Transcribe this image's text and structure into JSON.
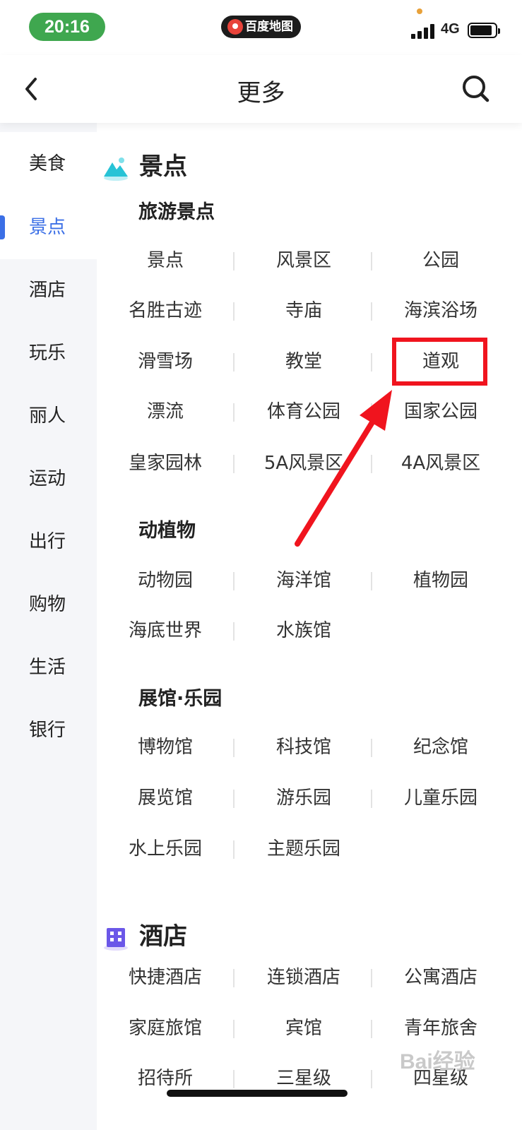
{
  "status_bar": {
    "time": "20:16",
    "app_name": "百度地图",
    "network": "4G"
  },
  "header": {
    "title": "更多"
  },
  "sidebar": {
    "items": [
      {
        "label": "美食"
      },
      {
        "label": "景点"
      },
      {
        "label": "酒店"
      },
      {
        "label": "玩乐"
      },
      {
        "label": "丽人"
      },
      {
        "label": "运动"
      },
      {
        "label": "出行"
      },
      {
        "label": "购物"
      },
      {
        "label": "生活"
      },
      {
        "label": "银行"
      }
    ],
    "active": "景点"
  },
  "sections": {
    "scenic": {
      "title": "景点",
      "tourism": {
        "title": "旅游景点",
        "rows": [
          [
            "景点",
            "风景区",
            "公园"
          ],
          [
            "名胜古迹",
            "寺庙",
            "海滨浴场"
          ],
          [
            "滑雪场",
            "教堂",
            "道观"
          ],
          [
            "漂流",
            "体育公园",
            "国家公园"
          ],
          [
            "皇家园林",
            "5A风景区",
            "4A风景区"
          ]
        ]
      },
      "animals": {
        "title": "动植物",
        "rows": [
          [
            "动物园",
            "海洋馆",
            "植物园"
          ],
          [
            "海底世界",
            "水族馆"
          ]
        ]
      },
      "museums": {
        "title": "展馆·乐园",
        "rows": [
          [
            "博物馆",
            "科技馆",
            "纪念馆"
          ],
          [
            "展览馆",
            "游乐园",
            "儿童乐园"
          ],
          [
            "水上乐园",
            "主题乐园"
          ]
        ]
      }
    },
    "hotel": {
      "title": "酒店",
      "rows": [
        [
          "快捷酒店",
          "连锁酒店",
          "公寓酒店"
        ],
        [
          "家庭旅馆",
          "宾馆",
          "青年旅舍"
        ],
        [
          "招待所",
          "三星级",
          "四星级"
        ]
      ]
    }
  },
  "colors": {
    "accent": "#3b6fe6",
    "highlight": "#f0141e",
    "time_pill": "#3fa74f"
  },
  "watermark": "Bai经验"
}
